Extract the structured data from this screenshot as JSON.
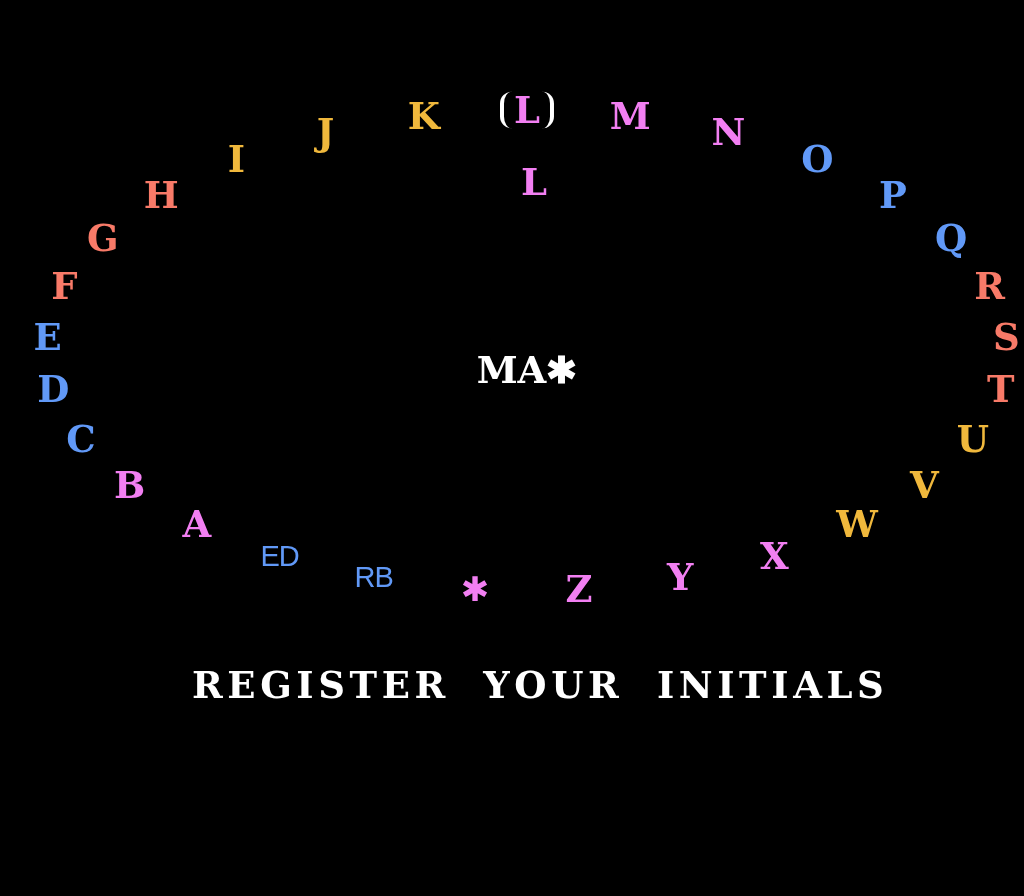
{
  "ring": [
    {
      "label": "K",
      "kind": "letter",
      "color": "#f0b83c",
      "selected": false
    },
    {
      "label": "L",
      "kind": "letter",
      "color": "#f27ff2",
      "selected": true
    },
    {
      "label": "M",
      "kind": "letter",
      "color": "#f27ff2",
      "selected": false
    },
    {
      "label": "J",
      "kind": "letter",
      "color": "#f0b83c",
      "selected": false
    },
    {
      "label": "N",
      "kind": "letter",
      "color": "#f27ff2",
      "selected": false
    },
    {
      "label": "I",
      "kind": "letter",
      "color": "#f0b83c",
      "selected": false
    },
    {
      "label": "O",
      "kind": "letter",
      "color": "#6199f7",
      "selected": false
    },
    {
      "label": "H",
      "kind": "letter",
      "color": "#f87a68",
      "selected": false
    },
    {
      "label": "P",
      "kind": "letter",
      "color": "#6199f7",
      "selected": false
    },
    {
      "label": "G",
      "kind": "letter",
      "color": "#f87a68",
      "selected": false
    },
    {
      "label": "Q",
      "kind": "letter",
      "color": "#6199f7",
      "selected": false
    },
    {
      "label": "F",
      "kind": "letter",
      "color": "#f87a68",
      "selected": false
    },
    {
      "label": "R",
      "kind": "letter",
      "color": "#f87a68",
      "selected": false
    },
    {
      "label": "E",
      "kind": "letter",
      "color": "#6199f7",
      "selected": false
    },
    {
      "label": "S",
      "kind": "letter",
      "color": "#f87a68",
      "selected": false
    },
    {
      "label": "D",
      "kind": "letter",
      "color": "#6199f7",
      "selected": false
    },
    {
      "label": "T",
      "kind": "letter",
      "color": "#f87a68",
      "selected": false
    },
    {
      "label": "C",
      "kind": "letter",
      "color": "#6199f7",
      "selected": false
    },
    {
      "label": "U",
      "kind": "letter",
      "color": "#f0b83c",
      "selected": false
    },
    {
      "label": "B",
      "kind": "letter",
      "color": "#f27ff2",
      "selected": false
    },
    {
      "label": "V",
      "kind": "letter",
      "color": "#f0b83c",
      "selected": false
    },
    {
      "label": "A",
      "kind": "letter",
      "color": "#f27ff2",
      "selected": false
    },
    {
      "label": "W",
      "kind": "letter",
      "color": "#f0b83c",
      "selected": false
    },
    {
      "label": "ED",
      "kind": "command",
      "color": "#6199f7",
      "selected": false
    },
    {
      "label": "X",
      "kind": "letter",
      "color": "#f27ff2",
      "selected": false
    },
    {
      "label": "RB",
      "kind": "command",
      "color": "#6199f7",
      "selected": false
    },
    {
      "label": "Y",
      "kind": "letter",
      "color": "#f27ff2",
      "selected": false
    },
    {
      "label": "✱",
      "kind": "symbol",
      "color": "#f27ff2",
      "selected": false
    },
    {
      "label": "Z",
      "kind": "letter",
      "color": "#f27ff2",
      "selected": false
    }
  ],
  "preview": "L",
  "entry": "MA✱",
  "caption": "REGISTER YOUR INITIALS"
}
